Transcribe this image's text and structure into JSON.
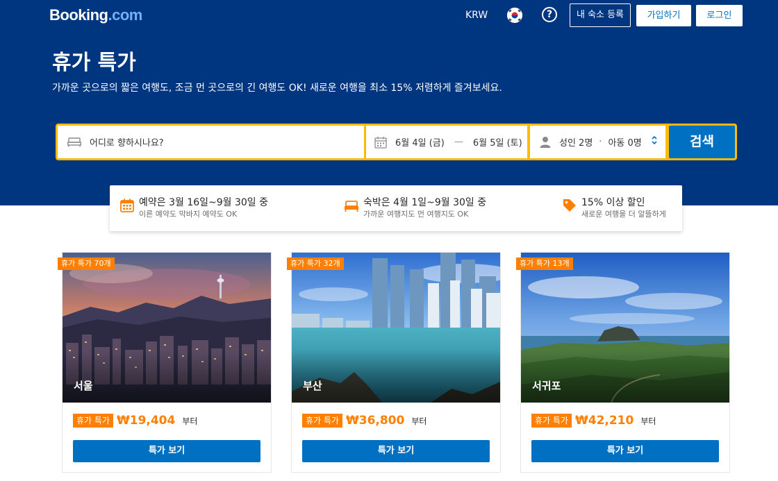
{
  "header": {
    "logo_main": "Booking",
    "logo_tld": ".com",
    "currency": "KRW",
    "help_symbol": "?",
    "list_property": "내 숙소 등록",
    "signup": "가입하기",
    "login": "로그인"
  },
  "hero": {
    "title": "휴가 특가",
    "subtitle": "가까운 곳으로의 짧은 여행도, 조금 먼 곳으로의 긴 여행도 OK! 새로운 여행을 최소 15% 저렴하게 즐겨보세요."
  },
  "search": {
    "destination_placeholder": "어디로 향하시나요?",
    "checkin": "6월 4일 (금)",
    "date_separator": "—",
    "checkout": "6월 5일 (토)",
    "adults": "성인 2명",
    "guest_separator": "·",
    "children": "아동 0명",
    "button": "검색"
  },
  "info": [
    {
      "title": "예약은 3월 16일~9월 30일 중",
      "sub": "이른 예약도 막바지 예약도 OK",
      "icon": "calendar-icon"
    },
    {
      "title": "숙박은 4월 1일~9월 30일 중",
      "sub": "가까운 여행지도 먼 여행지도 OK",
      "icon": "bed-icon"
    },
    {
      "title": "15% 이상 할인",
      "sub": "새로운 여행을 더 알뜰하게",
      "icon": "tag-icon"
    }
  ],
  "cards": [
    {
      "city": "서울",
      "ribbon": "휴가 특가 70개",
      "badge": "휴가 특가",
      "price": "₩19,404",
      "suffix": "부터",
      "button": "특가 보기"
    },
    {
      "city": "부산",
      "ribbon": "휴가 특가 32개",
      "badge": "휴가 특가",
      "price": "₩36,800",
      "suffix": "부터",
      "button": "특가 보기"
    },
    {
      "city": "서귀포",
      "ribbon": "휴가 특가 13개",
      "badge": "휴가 특가",
      "price": "₩42,210",
      "suffix": "부터",
      "button": "특가 보기"
    }
  ],
  "colors": {
    "brand_blue": "#003580",
    "action_blue": "#0071c2",
    "search_yellow": "#febb02",
    "deal_orange": "#ff8000"
  }
}
